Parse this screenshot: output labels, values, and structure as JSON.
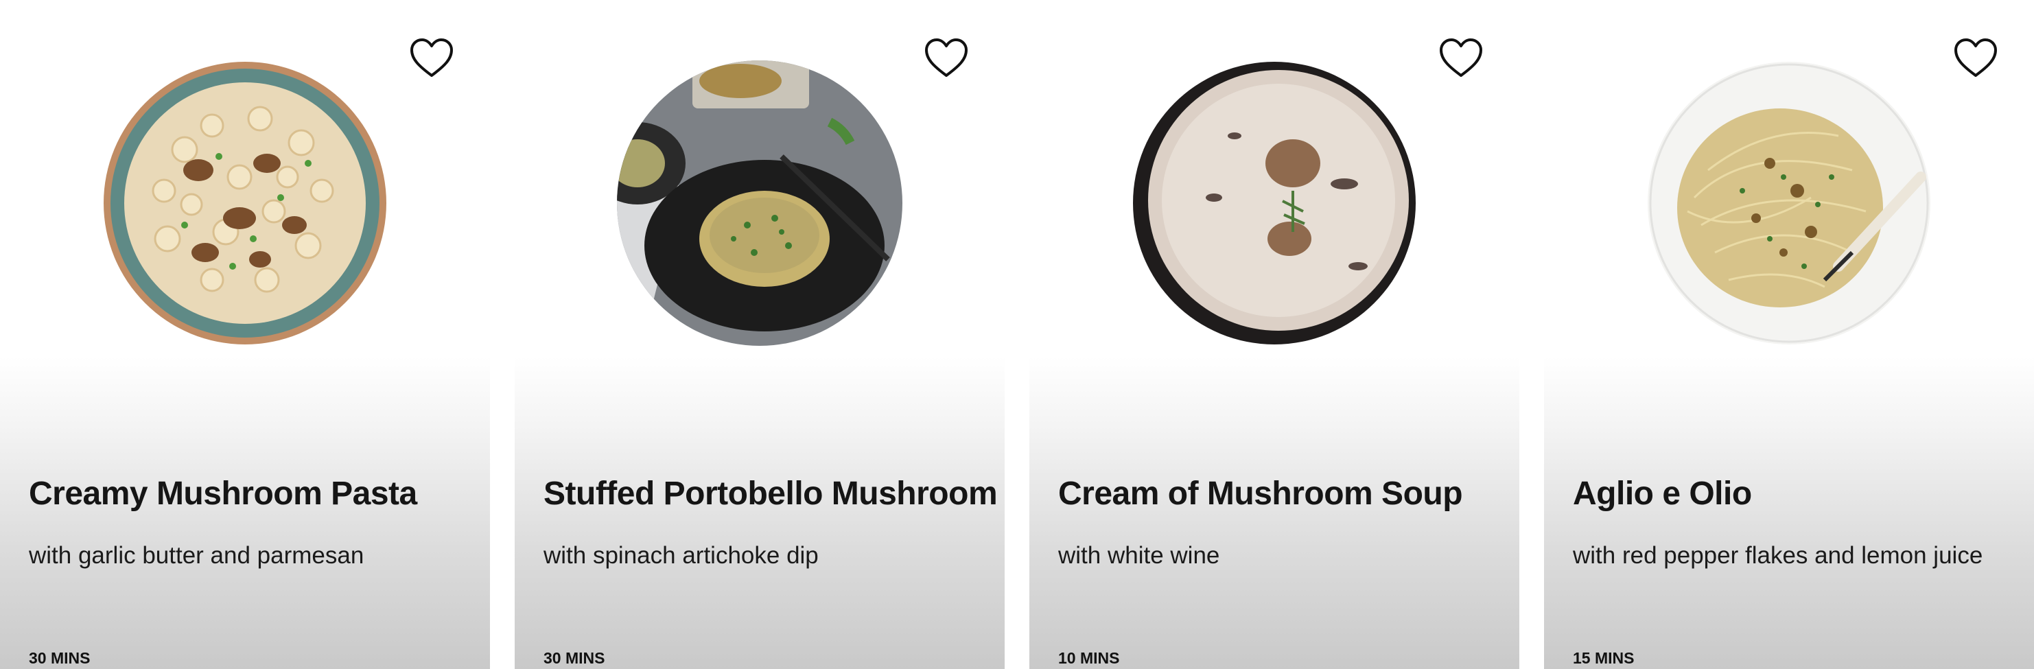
{
  "cards": [
    {
      "title": "Creamy Mushroom Pasta",
      "subtitle": "with garlic butter and parmesan",
      "time": "30 MINS",
      "image": "mushroom-pasta-photo"
    },
    {
      "title": "Stuffed Portobello Mushroom",
      "subtitle": "with spinach artichoke dip",
      "time": "30 MINS",
      "image": "stuffed-portobello-photo"
    },
    {
      "title": "Cream of Mushroom Soup",
      "subtitle": "with white wine",
      "time": "10 MINS",
      "image": "mushroom-soup-photo"
    },
    {
      "title": "Aglio e Olio",
      "subtitle": "with red pepper flakes and lemon juice",
      "time": "15 MINS",
      "image": "aglio-e-olio-photo"
    }
  ],
  "icons": {
    "favorite": "heart-outline-icon"
  }
}
